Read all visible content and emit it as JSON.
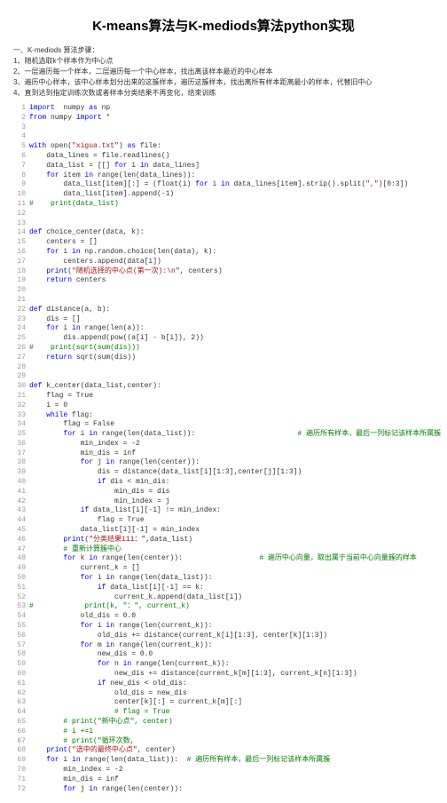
{
  "title": "K-means算法与K-mediods算法python实现",
  "section_heading": "一、K-mediods 算法步骤：",
  "steps": [
    "1、随机选取k个样本作为中心点",
    "2、一层遍历每一个样本，二层遍历每一个中心样本，找出离该样本最近的中心样本",
    "3、遍历中心样本，该中心样本划分出来的这簇样本，遍历这簇样本，找出离所有样本距离最小的样本，代替旧中心",
    "4、直到达到指定训练次数或者样本分类结果不再变化，结束训练"
  ],
  "code_lines": [
    {
      "n": 1,
      "t": [
        {
          "c": "kw",
          "s": "import"
        },
        {
          "s": "  numpy "
        },
        {
          "c": "kw",
          "s": "as"
        },
        {
          "s": " np"
        }
      ]
    },
    {
      "n": 2,
      "t": [
        {
          "c": "kw",
          "s": "from"
        },
        {
          "s": " numpy "
        },
        {
          "c": "kw",
          "s": "import"
        },
        {
          "s": " *"
        }
      ]
    },
    {
      "n": 3,
      "t": []
    },
    {
      "n": 4,
      "t": []
    },
    {
      "n": 5,
      "t": [
        {
          "c": "kw",
          "s": "with"
        },
        {
          "s": " open("
        },
        {
          "c": "str",
          "s": "\"xigua.txt\""
        },
        {
          "s": ") "
        },
        {
          "c": "kw",
          "s": "as"
        },
        {
          "s": " file:"
        }
      ]
    },
    {
      "n": 6,
      "t": [
        {
          "s": "    data_lines = file.readlines()"
        }
      ]
    },
    {
      "n": 7,
      "t": [
        {
          "s": "    data_list = [[] "
        },
        {
          "c": "kw",
          "s": "for"
        },
        {
          "s": " i "
        },
        {
          "c": "kw",
          "s": "in"
        },
        {
          "s": " data_lines]"
        }
      ]
    },
    {
      "n": 8,
      "t": [
        {
          "s": "    "
        },
        {
          "c": "kw",
          "s": "for"
        },
        {
          "s": " item "
        },
        {
          "c": "kw",
          "s": "in"
        },
        {
          "s": " range(len(data_lines)):"
        }
      ]
    },
    {
      "n": 9,
      "t": [
        {
          "s": "        data_list[item][:] = (float(i) "
        },
        {
          "c": "kw",
          "s": "for"
        },
        {
          "s": " i "
        },
        {
          "c": "kw",
          "s": "in"
        },
        {
          "s": " data_lines[item].strip().split("
        },
        {
          "c": "str",
          "s": "\",\""
        },
        {
          "s": ")[0:3])"
        }
      ]
    },
    {
      "n": 10,
      "t": [
        {
          "s": "        data_list[item].append(-1)"
        }
      ]
    },
    {
      "n": 11,
      "t": [
        {
          "c": "com",
          "s": "#    print(data_list)"
        }
      ]
    },
    {
      "n": 12,
      "t": []
    },
    {
      "n": 13,
      "t": []
    },
    {
      "n": 14,
      "t": [
        {
          "c": "kw",
          "s": "def"
        },
        {
          "s": " choice_center(data, k):"
        }
      ]
    },
    {
      "n": 15,
      "t": [
        {
          "s": "    centers = []"
        }
      ]
    },
    {
      "n": 16,
      "t": [
        {
          "s": "    "
        },
        {
          "c": "kw",
          "s": "for"
        },
        {
          "s": " i "
        },
        {
          "c": "kw",
          "s": "in"
        },
        {
          "s": " np.random.choice(len(data), k):"
        }
      ]
    },
    {
      "n": 17,
      "t": [
        {
          "s": "        centers.append(data[i])"
        }
      ]
    },
    {
      "n": 18,
      "t": [
        {
          "s": "    "
        },
        {
          "c": "kw",
          "s": "print"
        },
        {
          "s": "("
        },
        {
          "c": "str",
          "s": "\"随机选择的中心点(第一次):\\n\""
        },
        {
          "s": ", centers)"
        }
      ]
    },
    {
      "n": 19,
      "t": [
        {
          "s": "    "
        },
        {
          "c": "kw",
          "s": "return"
        },
        {
          "s": " centers"
        }
      ]
    },
    {
      "n": 20,
      "t": []
    },
    {
      "n": 21,
      "t": []
    },
    {
      "n": 22,
      "t": [
        {
          "c": "kw",
          "s": "def"
        },
        {
          "s": " distance(a, b):"
        }
      ]
    },
    {
      "n": 23,
      "t": [
        {
          "s": "    dis = []"
        }
      ]
    },
    {
      "n": 24,
      "t": [
        {
          "s": "    "
        },
        {
          "c": "kw",
          "s": "for"
        },
        {
          "s": " i "
        },
        {
          "c": "kw",
          "s": "in"
        },
        {
          "s": " range(len(a)):"
        }
      ]
    },
    {
      "n": 25,
      "t": [
        {
          "s": "        dis.append(pow((a[i] - b[i]), 2))"
        }
      ]
    },
    {
      "n": 26,
      "t": [
        {
          "c": "com",
          "s": "#    print(sqrt(sum(dis)))"
        }
      ]
    },
    {
      "n": 27,
      "t": [
        {
          "s": "    "
        },
        {
          "c": "kw",
          "s": "return"
        },
        {
          "s": " sqrt(sum(dis))"
        }
      ]
    },
    {
      "n": 28,
      "t": []
    },
    {
      "n": 29,
      "t": []
    },
    {
      "n": 30,
      "t": [
        {
          "c": "kw",
          "s": "def"
        },
        {
          "s": " k_center(data_list,center):"
        }
      ]
    },
    {
      "n": 31,
      "t": [
        {
          "s": "    flag = True"
        }
      ]
    },
    {
      "n": 32,
      "t": [
        {
          "s": "    i = 0"
        }
      ]
    },
    {
      "n": 33,
      "t": [
        {
          "s": "    "
        },
        {
          "c": "kw",
          "s": "while"
        },
        {
          "s": " flag:"
        }
      ]
    },
    {
      "n": 34,
      "t": [
        {
          "s": "        flag = False"
        }
      ]
    },
    {
      "n": 35,
      "t": [
        {
          "s": "        "
        },
        {
          "c": "kw",
          "s": "for"
        },
        {
          "s": " i "
        },
        {
          "c": "kw",
          "s": "in"
        },
        {
          "s": " range(len(data_list)):                        "
        },
        {
          "c": "com",
          "s": "# 遍历所有样本，最后一列标记该样本所属簇"
        }
      ]
    },
    {
      "n": 36,
      "t": [
        {
          "s": "            min_index = -2"
        }
      ]
    },
    {
      "n": 37,
      "t": [
        {
          "s": "            min_dis = inf"
        }
      ]
    },
    {
      "n": 38,
      "t": [
        {
          "s": "            "
        },
        {
          "c": "kw",
          "s": "for"
        },
        {
          "s": " j "
        },
        {
          "c": "kw",
          "s": "in"
        },
        {
          "s": " range(len(center)):"
        }
      ]
    },
    {
      "n": 39,
      "t": [
        {
          "s": "                dis = distance(data_list[i][1:3],center[j][1:3])"
        }
      ]
    },
    {
      "n": 40,
      "t": [
        {
          "s": "                "
        },
        {
          "c": "kw",
          "s": "if"
        },
        {
          "s": " dis < min_dis:"
        }
      ]
    },
    {
      "n": 41,
      "t": [
        {
          "s": "                    min_dis = dis"
        }
      ]
    },
    {
      "n": 42,
      "t": [
        {
          "s": "                    min_index = j"
        }
      ]
    },
    {
      "n": 43,
      "t": [
        {
          "s": "            "
        },
        {
          "c": "kw",
          "s": "if"
        },
        {
          "s": " data_list[i][-1] != min_index:"
        }
      ]
    },
    {
      "n": 44,
      "t": [
        {
          "s": "                flag = True"
        }
      ]
    },
    {
      "n": 45,
      "t": [
        {
          "s": "            data_list[i][-1] = min_index"
        }
      ]
    },
    {
      "n": 46,
      "t": [
        {
          "s": "        "
        },
        {
          "c": "kw",
          "s": "print"
        },
        {
          "s": "("
        },
        {
          "c": "str",
          "s": "\"分类结果111：\""
        },
        {
          "s": ",data_list)"
        }
      ]
    },
    {
      "n": 47,
      "t": [
        {
          "s": "        "
        },
        {
          "c": "com",
          "s": "# 重新计算簇中心"
        }
      ]
    },
    {
      "n": 48,
      "t": [
        {
          "s": "        "
        },
        {
          "c": "kw",
          "s": "for"
        },
        {
          "s": " k "
        },
        {
          "c": "kw",
          "s": "in"
        },
        {
          "s": " range(len(center)):                  "
        },
        {
          "c": "com",
          "s": "# 遍历中心向量，取出属于当前中心向量簇的样本"
        }
      ]
    },
    {
      "n": 49,
      "t": [
        {
          "s": "            current_k = []"
        }
      ]
    },
    {
      "n": 50,
      "t": [
        {
          "s": "            "
        },
        {
          "c": "kw",
          "s": "for"
        },
        {
          "s": " i "
        },
        {
          "c": "kw",
          "s": "in"
        },
        {
          "s": " range(len(data_list)):"
        }
      ]
    },
    {
      "n": 51,
      "t": [
        {
          "s": "                "
        },
        {
          "c": "kw",
          "s": "if"
        },
        {
          "s": " data_list[i][-1] == k:"
        }
      ]
    },
    {
      "n": 52,
      "t": [
        {
          "s": "                    current_k.append(data_list[i])"
        }
      ]
    },
    {
      "n": 53,
      "t": [
        {
          "c": "com",
          "s": "#            print(k, \"：\", current_k)"
        }
      ]
    },
    {
      "n": 54,
      "t": [
        {
          "s": "            old_dis = 0.0"
        }
      ]
    },
    {
      "n": 55,
      "t": [
        {
          "s": "            "
        },
        {
          "c": "kw",
          "s": "for"
        },
        {
          "s": " i "
        },
        {
          "c": "kw",
          "s": "in"
        },
        {
          "s": " range(len(current_k)):"
        }
      ]
    },
    {
      "n": 56,
      "t": [
        {
          "s": "                old_dis += distance(current_k[i][1:3], center[k][1:3])"
        }
      ]
    },
    {
      "n": 57,
      "t": [
        {
          "s": "            "
        },
        {
          "c": "kw",
          "s": "for"
        },
        {
          "s": " m "
        },
        {
          "c": "kw",
          "s": "in"
        },
        {
          "s": " range(len(current_k)):"
        }
      ]
    },
    {
      "n": 58,
      "t": [
        {
          "s": "                new_dis = 0.0"
        }
      ]
    },
    {
      "n": 59,
      "t": [
        {
          "s": "                "
        },
        {
          "c": "kw",
          "s": "for"
        },
        {
          "s": " n "
        },
        {
          "c": "kw",
          "s": "in"
        },
        {
          "s": " range(len(current_k)):"
        }
      ]
    },
    {
      "n": 60,
      "t": [
        {
          "s": "                    new_dis += distance(current_k[m][1:3], current_k[n][1:3])"
        }
      ]
    },
    {
      "n": 61,
      "t": [
        {
          "s": "                "
        },
        {
          "c": "kw",
          "s": "if"
        },
        {
          "s": " new_dis < old_dis:"
        }
      ]
    },
    {
      "n": 62,
      "t": [
        {
          "s": "                    old_dis = new_dis"
        }
      ]
    },
    {
      "n": 63,
      "t": [
        {
          "s": "                    center[k][:] = current_k[m][:]"
        }
      ]
    },
    {
      "n": 64,
      "t": [
        {
          "s": "                    "
        },
        {
          "c": "com",
          "s": "# flag = True"
        }
      ]
    },
    {
      "n": 65,
      "t": [
        {
          "s": "        "
        },
        {
          "c": "com",
          "s": "# print(\"新中心点\", center)"
        }
      ]
    },
    {
      "n": 66,
      "t": [
        {
          "s": "        "
        },
        {
          "c": "com",
          "s": "# i +=1"
        }
      ]
    },
    {
      "n": 67,
      "t": [
        {
          "s": "        "
        },
        {
          "c": "com",
          "s": "# print(\"循环次数,"
        }
      ]
    },
    {
      "n": 68,
      "t": [
        {
          "s": "    "
        },
        {
          "c": "kw",
          "s": "print"
        },
        {
          "s": "("
        },
        {
          "c": "str",
          "s": "\"选中的最终中心点\""
        },
        {
          "s": ", center)"
        }
      ]
    },
    {
      "n": 69,
      "t": [
        {
          "s": "    "
        },
        {
          "c": "kw",
          "s": "for"
        },
        {
          "s": " i "
        },
        {
          "c": "kw",
          "s": "in"
        },
        {
          "s": " range(len(data_list)):  "
        },
        {
          "c": "com",
          "s": "# 遍历所有样本，最后一列标记该样本所属簇"
        }
      ]
    },
    {
      "n": 70,
      "t": [
        {
          "s": "        min_index = -2"
        }
      ]
    },
    {
      "n": 71,
      "t": [
        {
          "s": "        min_dis = inf"
        }
      ]
    },
    {
      "n": 72,
      "t": [
        {
          "s": "        "
        },
        {
          "c": "kw",
          "s": "for"
        },
        {
          "s": " j "
        },
        {
          "c": "kw",
          "s": "in"
        },
        {
          "s": " range(len(center)):"
        }
      ]
    }
  ]
}
